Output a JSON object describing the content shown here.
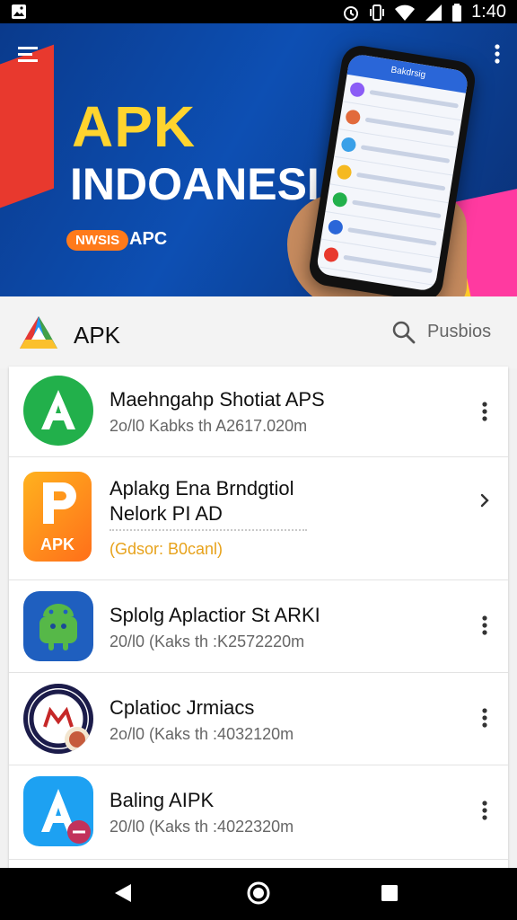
{
  "status_bar": {
    "time": "1:40",
    "icons": [
      "image-icon",
      "alarm-icon",
      "vibrate-icon",
      "wifi-icon",
      "signal-icon",
      "battery-icon"
    ]
  },
  "banner": {
    "title_line1": "APK",
    "title_line2": "INDOANESIA",
    "badge": "NWSIS",
    "subtitle": "APC",
    "phone_header": "Bakdrsig",
    "colors": {
      "background": "#0d4fb3",
      "title": "#ffd42e",
      "badge": "#ff7a1a"
    }
  },
  "header": {
    "title": "APK",
    "search_label": "Pusbios"
  },
  "apps": [
    {
      "name": "Maehngahp Shotiat APS",
      "meta": "2o/l0 Kabks  th A2617.020m",
      "icon": "green-a-icon"
    },
    {
      "name": "Aplakg Ena Brndgtiol",
      "name2": "Nelork PI AD",
      "orange": "(Gdsor: B0canl)",
      "icon": "apk-p-icon",
      "icon_label": "APK"
    },
    {
      "name": "Splolg Aplactior St ARKI",
      "meta": "20/l0 (Kaks  th :K2572220m",
      "icon": "android-icon"
    },
    {
      "name": "Cplatioc Jrmiacs",
      "meta": "2o/l0 (Kaks  th :4032120m",
      "icon": "badge-m-icon"
    },
    {
      "name": "Baling AIPK",
      "meta": "20/l0 (Kaks  th :4022320m",
      "icon": "blue-a-icon"
    }
  ],
  "navigation": {
    "buttons": [
      "back-icon",
      "home-icon",
      "recents-icon"
    ]
  }
}
